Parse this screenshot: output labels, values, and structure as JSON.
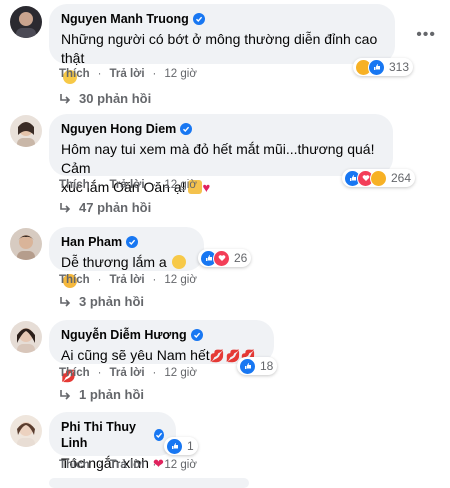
{
  "actions": {
    "like_label": "Thích",
    "reply_label": "Trả lời",
    "separator": "·",
    "time": "12 giờ"
  },
  "comments": [
    {
      "author": "Nguyen Manh Truong",
      "text": "Những người có bớt ở mông thường diễn đỉnh cao thật",
      "reaction_count": "313",
      "replies": "30 phản hồi",
      "reactions": [
        "haha",
        "like"
      ]
    },
    {
      "author": "Nguyen Hong Diem",
      "text_line1": "Hôm nay tui xem mà đỏ hết mắt mũi...thương quá! Cảm",
      "text_line2": "xúc lắm Oăn Oăn ạ!",
      "reaction_count": "264",
      "replies": "47 phản hồi",
      "reactions": [
        "like",
        "love",
        "care"
      ]
    },
    {
      "author": "Han Pham",
      "text": "Dễ thương lắm a",
      "reaction_count": "26",
      "replies": "3 phản hồi",
      "reactions": [
        "like",
        "love"
      ]
    },
    {
      "author": "Nguyễn Diễm Hương",
      "text": "Ai cũng sẽ yêu Nam hết",
      "reaction_count": "18",
      "replies": "1 phản hồi",
      "reactions": [
        "like"
      ]
    },
    {
      "author": "Phi Thi Thuy Linh",
      "text": "Tóc ngắn xinh",
      "reaction_count": "1",
      "reactions": [
        "like"
      ]
    }
  ],
  "more_icon": "•••"
}
